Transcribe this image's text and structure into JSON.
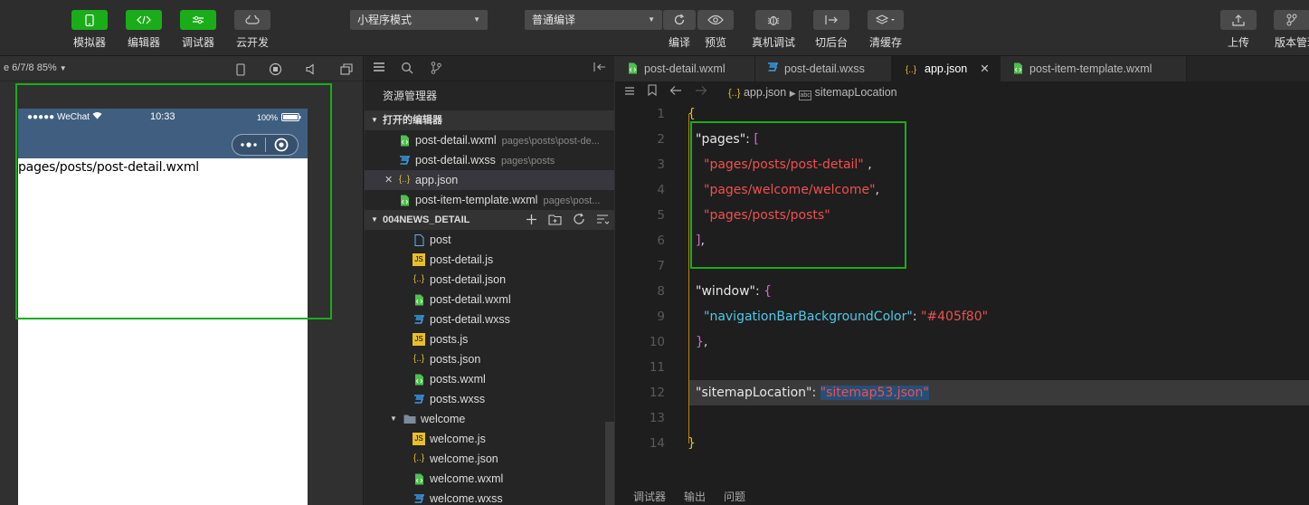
{
  "toolbar": {
    "simulator": "模拟器",
    "editor": "编辑器",
    "debugger": "调试器",
    "cloud": "云开发",
    "mode_select": "小程序模式",
    "compile_select": "普通编译",
    "compile": "编译",
    "preview": "预览",
    "remote_debug": "真机调试",
    "background": "切后台",
    "clear_cache": "清缓存",
    "upload": "上传",
    "version": "版本管理"
  },
  "simulator": {
    "device_label": "e 6/7/8 85%",
    "status_left": "●●●●● WeChat",
    "status_time": "10:33",
    "status_battery": "100%",
    "page_text": "pages/posts/post-detail.wxml"
  },
  "explorer": {
    "title": "资源管理器",
    "open_editors": "打开的编辑器",
    "open_files": [
      {
        "name": "post-detail.wxml",
        "desc": "pages\\posts\\post-de...",
        "type": "wxml"
      },
      {
        "name": "post-detail.wxss",
        "desc": "pages\\posts",
        "type": "wxss"
      },
      {
        "name": "app.json",
        "desc": "",
        "type": "json"
      },
      {
        "name": "post-item-template.wxml",
        "desc": "pages\\post...",
        "type": "wxml"
      }
    ],
    "project": "004NEWS_DETAIL",
    "tree": [
      {
        "name": "post",
        "type": "page"
      },
      {
        "name": "post-detail.js",
        "type": "js"
      },
      {
        "name": "post-detail.json",
        "type": "json"
      },
      {
        "name": "post-detail.wxml",
        "type": "wxml"
      },
      {
        "name": "post-detail.wxss",
        "type": "wxss"
      },
      {
        "name": "posts.js",
        "type": "js"
      },
      {
        "name": "posts.json",
        "type": "json"
      },
      {
        "name": "posts.wxml",
        "type": "wxml"
      },
      {
        "name": "posts.wxss",
        "type": "wxss"
      },
      {
        "name": "welcome",
        "type": "folder"
      },
      {
        "name": "welcome.js",
        "type": "js"
      },
      {
        "name": "welcome.json",
        "type": "json"
      },
      {
        "name": "welcome.wxml",
        "type": "wxml"
      },
      {
        "name": "welcome.wxss",
        "type": "wxss"
      }
    ]
  },
  "editor": {
    "tabs": [
      {
        "name": "post-detail.wxml",
        "icon": "<>"
      },
      {
        "name": "post-detail.wxss",
        "icon": "css"
      },
      {
        "name": "app.json",
        "icon": "{..}"
      },
      {
        "name": "post-item-template.wxml",
        "icon": "<>"
      }
    ],
    "breadcrumb_file": "app.json",
    "breadcrumb_symbol": "sitemapLocation",
    "line_numbers": [
      "1",
      "2",
      "3",
      "4",
      "5",
      "6",
      "7",
      "8",
      "9",
      "10",
      "11",
      "12",
      "13",
      "14"
    ],
    "code": {
      "l1": "{",
      "k_pages": "\"pages\"",
      "colon": ": ",
      "open_arr": "[",
      "p1": "\"pages/posts/post-detail\"",
      "p2": "\"pages/welcome/welcome\"",
      "p3": "\"pages/posts/posts\"",
      "comma": ",",
      "sp_comma": " ,",
      "close_arr": "]",
      "k_window": "\"window\"",
      "open_obj": "{",
      "k_navbg": "\"navigationBarBackgroundColor\"",
      "v_navbg": "\"#405f80\"",
      "close_obj": "}",
      "k_sitemap": "\"sitemapLocation\"",
      "v_sitemap": "\"sitemap53.json\"",
      "l14": "}"
    }
  },
  "bottom_panel": {
    "debugger": "调试器",
    "output": "输出",
    "problems": "问题"
  },
  "colors": {
    "accent_green": "#1aad19",
    "nav_bar": "#405f80",
    "string": "#f0504f"
  }
}
